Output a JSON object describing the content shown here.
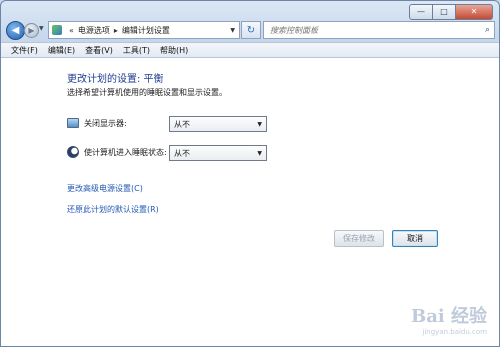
{
  "window": {
    "caption": {
      "min_glyph": "—",
      "max_glyph": "□",
      "close_glyph": "✕"
    }
  },
  "address_bar": {
    "back_glyph": "◀",
    "forward_glyph": "▶",
    "overflow": "«",
    "crumbs": [
      "电源选项",
      "编辑计划设置"
    ],
    "separator": "▸",
    "dropdown_glyph": "▼",
    "refresh_glyph": "↻"
  },
  "search": {
    "placeholder": "搜索控制面板",
    "icon_glyph": "⌕"
  },
  "menu": {
    "items": [
      "文件(F)",
      "编辑(E)",
      "查看(V)",
      "工具(T)",
      "帮助(H)"
    ]
  },
  "page": {
    "title": "更改计划的设置: 平衡",
    "subtitle": "选择希望计算机使用的睡眠设置和显示设置。"
  },
  "settings": [
    {
      "label": "关闭显示器:",
      "value": "从不",
      "icon": "monitor-icon"
    },
    {
      "label": "使计算机进入睡眠状态:",
      "value": "从不",
      "icon": "moon-icon"
    }
  ],
  "links": {
    "advanced": "更改高级电源设置(C)",
    "restore": "还原此计划的默认设置(R)"
  },
  "buttons": {
    "save": "保存修改",
    "cancel": "取消"
  },
  "watermark": {
    "logo": "Bai 经验",
    "sub": "jingyan.baidu.com"
  },
  "colors": {
    "accent": "#1e3d8f",
    "link": "#2358b5",
    "close": "#c34a33"
  }
}
